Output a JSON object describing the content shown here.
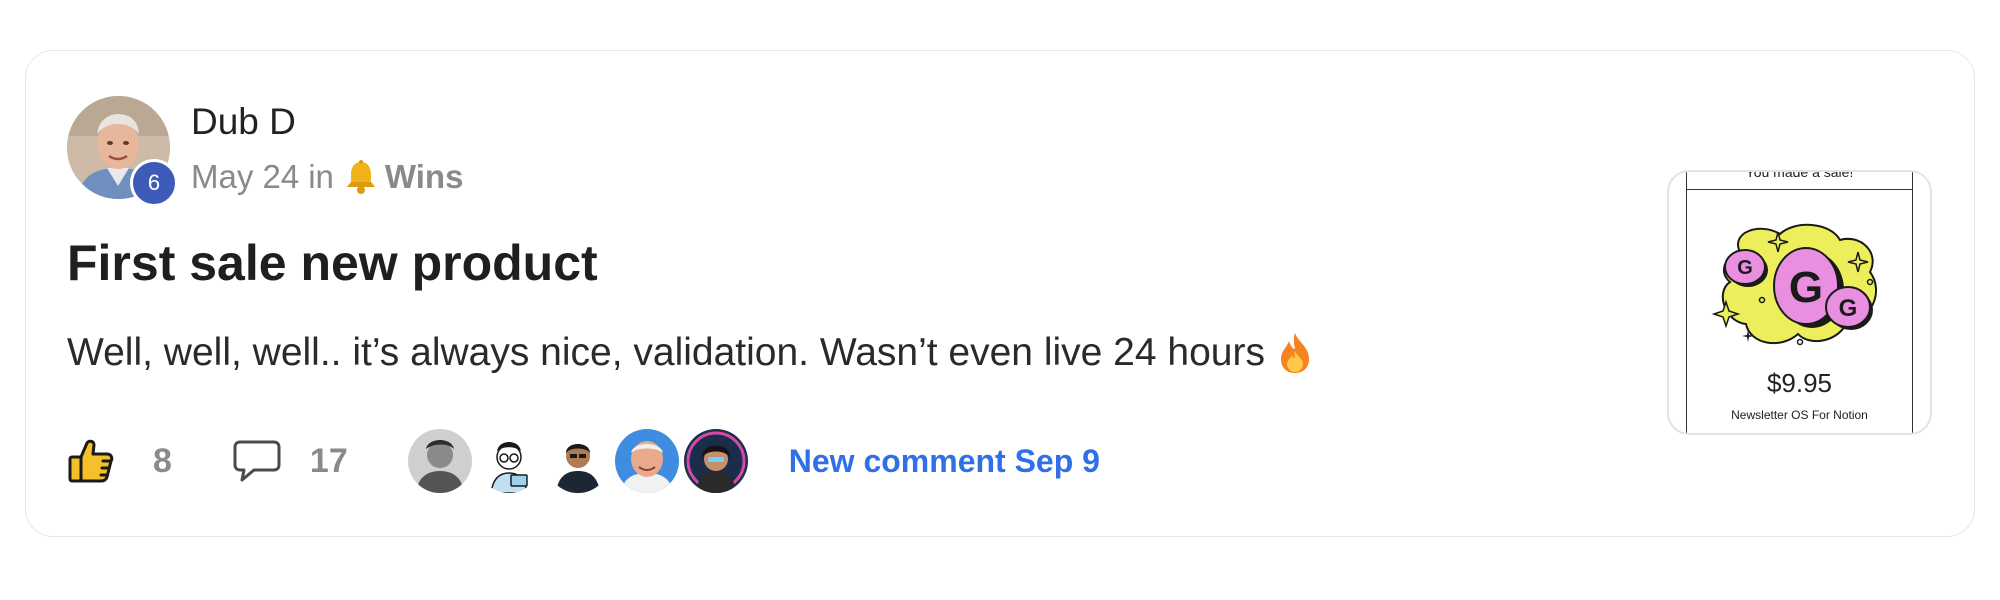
{
  "post": {
    "author_name": "Dub D",
    "author_level": "6",
    "date": "May 24",
    "in_word": "in",
    "category_icon": "bell-icon",
    "category": "Wins",
    "title": "First sale new product",
    "body": "Well, well, well.. it’s always nice, validation. Wasn’t even live 24 hours",
    "body_emoji": "fire-icon"
  },
  "actions": {
    "like_icon": "thumbs-up-icon",
    "likes": "8",
    "comment_icon": "comment-icon",
    "comments": "17",
    "participants": [
      "participant-1",
      "participant-2",
      "participant-3",
      "participant-4",
      "participant-5"
    ],
    "new_comment_label": "New comment Sep 9"
  },
  "attachment": {
    "header_text": "You made a sale!",
    "logo_letters": [
      "G",
      "G",
      "G"
    ],
    "price": "$9.95",
    "product_name": "Newsletter OS For Notion"
  },
  "colors": {
    "accent_blue": "#2f6fe8",
    "level_badge": "#3f5bb8",
    "logo_yellow": "#ecef5b",
    "logo_pink": "#ea8fe0"
  }
}
